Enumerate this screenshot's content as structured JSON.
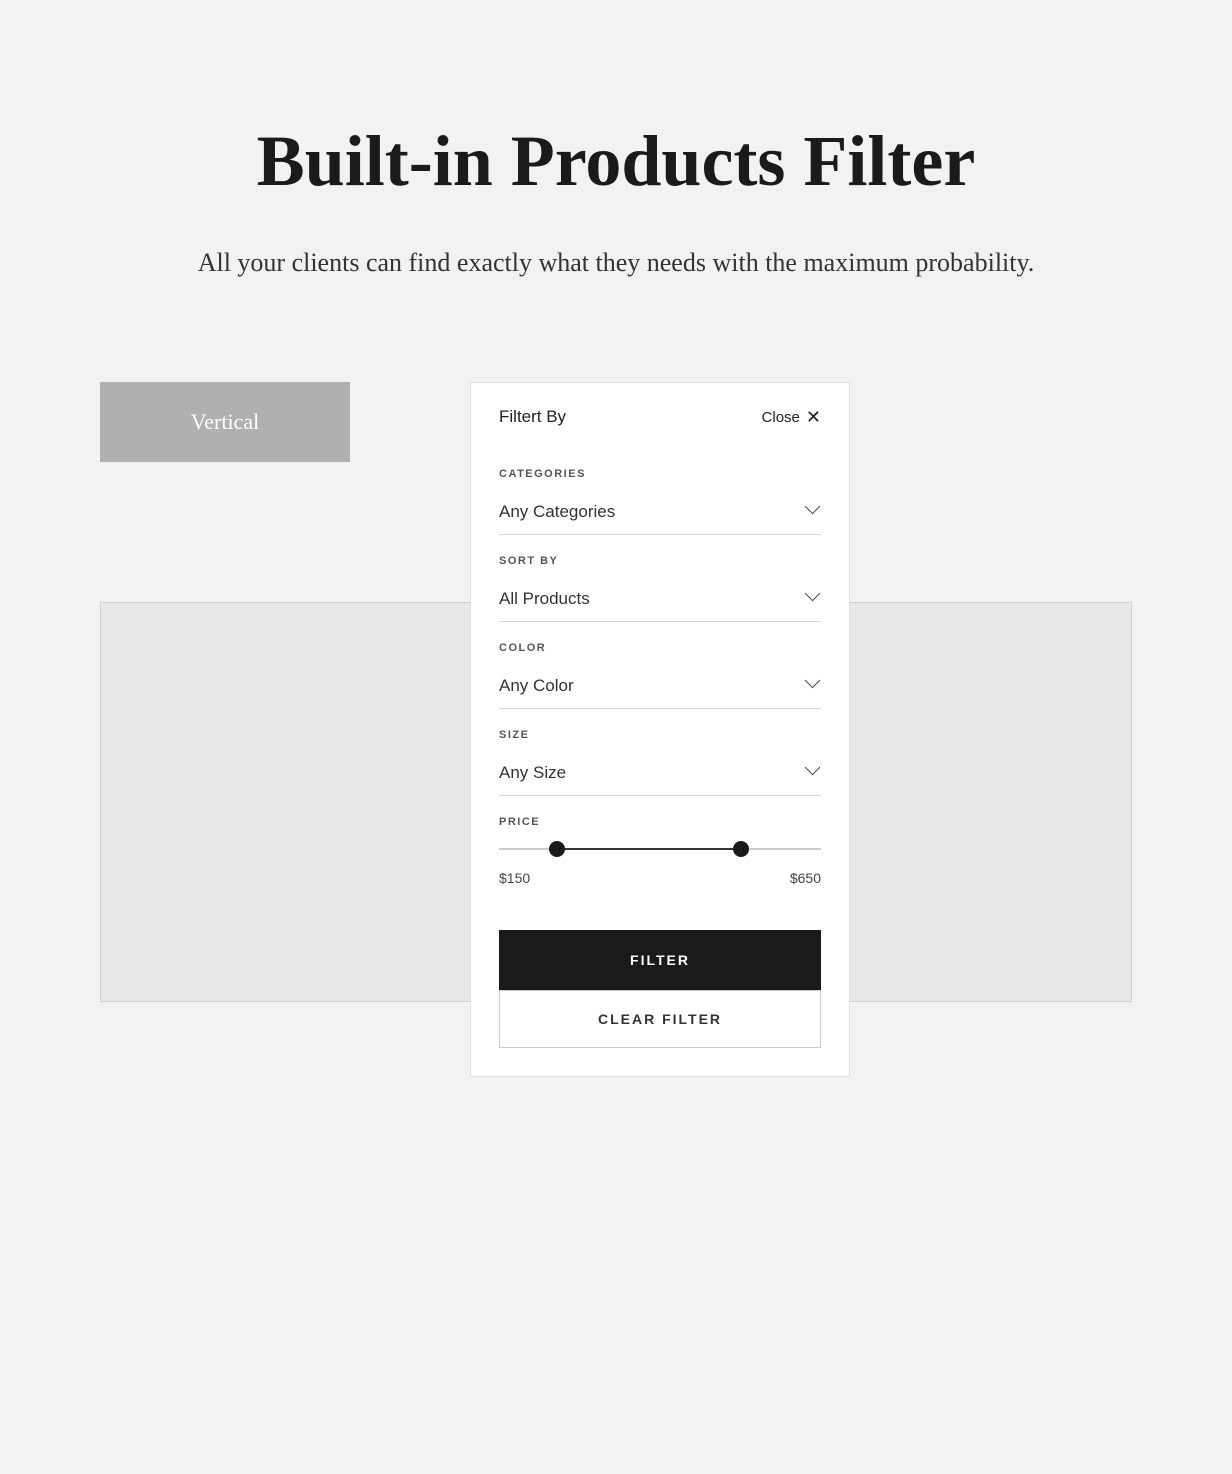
{
  "header": {
    "title": "Built-in Products Filter",
    "subtitle": "All your clients can find exactly what they needs with the maximum probability."
  },
  "vertical_button": {
    "label": "Vertical"
  },
  "filter_panel": {
    "title": "Filtert By",
    "close_label": "Close",
    "sections": {
      "categories": {
        "label": "CATEGORIES",
        "value": "Any Categories"
      },
      "sort_by": {
        "label": "SORT BY",
        "value": "All Products"
      },
      "color": {
        "label": "COLOR",
        "value": "Any Color"
      },
      "size": {
        "label": "SIZE",
        "value": "Any Size"
      },
      "price": {
        "label": "PRICE",
        "min_value": "$150",
        "max_value": "$650"
      }
    },
    "filter_button": "FILTER",
    "clear_button": "CLEAR FILTER"
  },
  "colors": {
    "background": "#f2f2f2",
    "panel_bg": "#ffffff",
    "button_bg": "#1a1a1a",
    "button_text": "#ffffff",
    "vertical_bg": "#b0b0b0"
  }
}
